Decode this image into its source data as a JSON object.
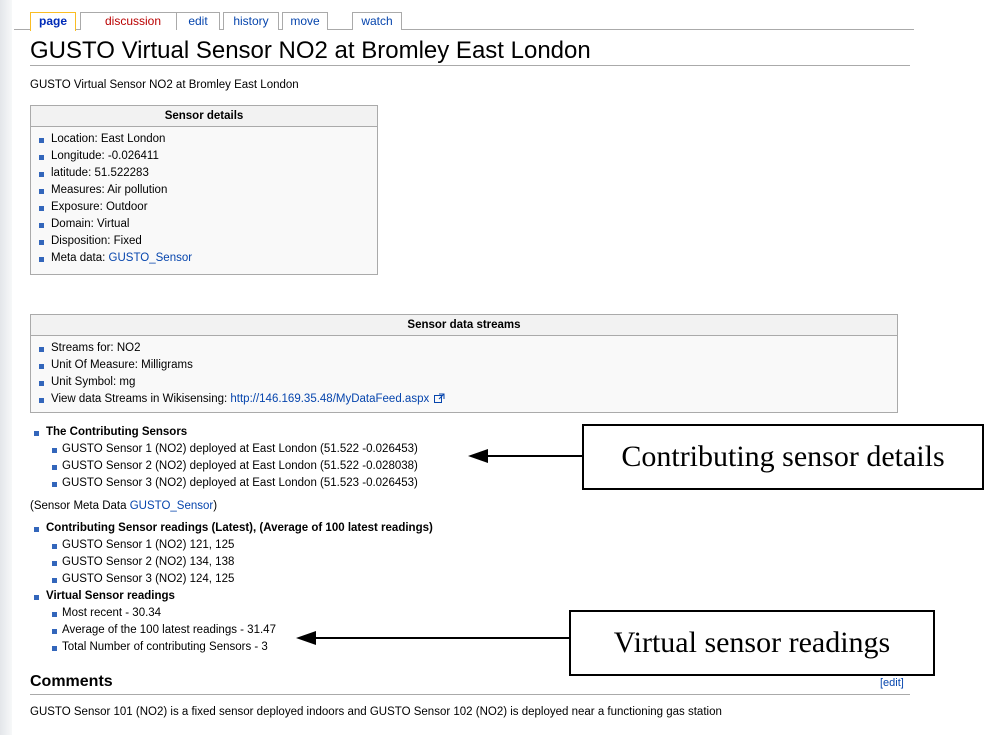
{
  "tabs": [
    {
      "label": "page"
    },
    {
      "label": "discussion"
    },
    {
      "label": "edit"
    },
    {
      "label": "history"
    },
    {
      "label": "move"
    },
    {
      "label": "watch"
    }
  ],
  "title": "GUSTO Virtual Sensor NO2 at Bromley East London",
  "subtitle": "GUSTO Virtual Sensor NO2 at Bromley East London",
  "sensor_details": {
    "heading": "Sensor details",
    "items": [
      "Location: East London",
      "Longitude: -0.026411",
      "latitude: 51.522283",
      "Measures: Air pollution",
      "Exposure: Outdoor",
      "Domain: Virtual",
      "Disposition: Fixed"
    ],
    "meta_label": "Meta data: ",
    "meta_link": "GUSTO_Sensor"
  },
  "streams": {
    "heading": "Sensor data streams",
    "items": [
      "Streams for: NO2",
      "Unit Of Measure: Milligrams",
      "Unit Symbol: mg"
    ],
    "view_label": "View data Streams in Wikisensing: ",
    "view_link": "http://146.169.35.48/MyDataFeed.aspx"
  },
  "contributing": {
    "heading": "The Contributing Sensors",
    "items": [
      "GUSTO Sensor 1 (NO2) deployed at East London (51.522 -0.026453)",
      "GUSTO Sensor 2 (NO2) deployed at East London (51.522 -0.028038)",
      "GUSTO Sensor 3 (NO2) deployed at East London (51.523 -0.026453)"
    ]
  },
  "meta_note": {
    "prefix": "(Sensor Meta Data ",
    "link": "GUSTO_Sensor",
    "suffix": ")"
  },
  "readings": {
    "heading": "Contributing Sensor readings (Latest), (Average of 100 latest readings)",
    "items": [
      "GUSTO Sensor 1 (NO2) 121, 125",
      "GUSTO Sensor 2 (NO2) 134, 138",
      "GUSTO Sensor 3 (NO2) 124, 125"
    ]
  },
  "virtual": {
    "heading": "Virtual Sensor readings",
    "items": [
      "Most recent - 30.34",
      "Average of the 100 latest readings - 31.47",
      "Total Number of contributing Sensors - 3"
    ]
  },
  "comments": {
    "heading": "Comments",
    "edit_label": "[edit]",
    "text": "GUSTO Sensor 101 (NO2) is a fixed sensor deployed indoors and GUSTO Sensor 102 (NO2) is deployed near a functioning gas station"
  },
  "callouts": {
    "contributing": "Contributing sensor details",
    "virtual": "Virtual sensor readings"
  },
  "colors": {
    "link": "#0645ad",
    "selected_tab_border": "#fabd23",
    "bullet": "#3366bb"
  }
}
